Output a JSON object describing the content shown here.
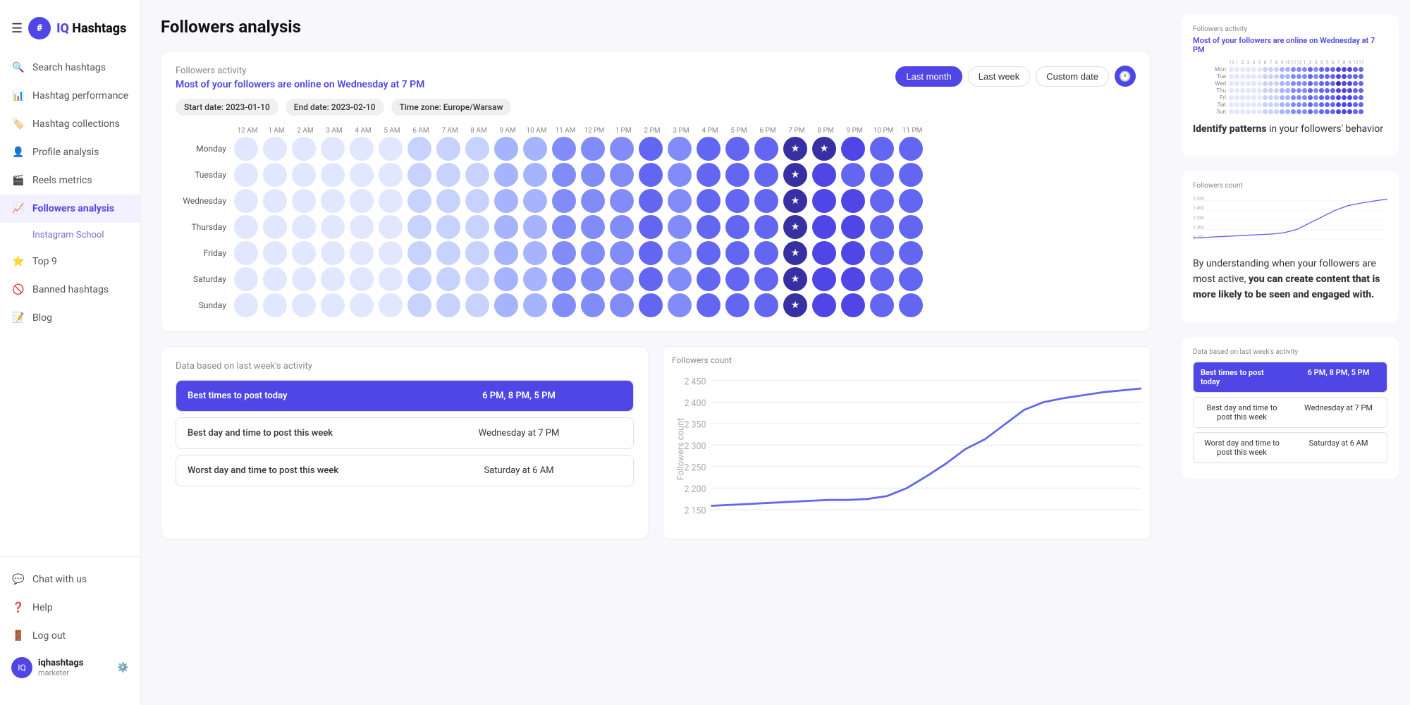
{
  "app": {
    "logo_symbol": "#",
    "logo_name_prefix": "IQ",
    "logo_name_suffix": " Hashtags"
  },
  "sidebar": {
    "hamburger": "☰",
    "items": [
      {
        "id": "search",
        "label": "Search hashtags",
        "icon": "🔍",
        "active": false
      },
      {
        "id": "hashtag-perf",
        "label": "Hashtag performance",
        "icon": "📊",
        "active": false
      },
      {
        "id": "hashtag-coll",
        "label": "Hashtag collections",
        "icon": "🏷️",
        "active": false
      },
      {
        "id": "profile",
        "label": "Profile analysis",
        "icon": "👤",
        "active": false
      },
      {
        "id": "reels",
        "label": "Reels metrics",
        "icon": "🎬",
        "active": false
      },
      {
        "id": "followers",
        "label": "Followers analysis",
        "icon": "📈",
        "active": true
      },
      {
        "id": "instagram-school",
        "label": "Instagram School",
        "icon": "🎓",
        "active": false,
        "sub": true
      },
      {
        "id": "top9",
        "label": "Top 9",
        "icon": "⭐",
        "active": false
      },
      {
        "id": "banned",
        "label": "Banned hashtags",
        "icon": "🚫",
        "active": false
      },
      {
        "id": "blog",
        "label": "Blog",
        "icon": "📝",
        "active": false
      }
    ],
    "user": {
      "initials": "IQ",
      "username": "iqhashtags",
      "role": "marketer"
    },
    "footer_items": [
      {
        "id": "chat",
        "label": "Chat with us",
        "icon": "💬"
      },
      {
        "id": "help",
        "label": "Help",
        "icon": "❓"
      },
      {
        "id": "logout",
        "label": "Log out",
        "icon": "🚪"
      }
    ]
  },
  "page": {
    "title": "Followers analysis"
  },
  "followers_activity": {
    "section_title": "Followers activity",
    "highlight": "Most of your followers are online on Wednesday at 7 PM",
    "filters": {
      "last_month": "Last month",
      "last_week": "Last week",
      "custom_date": "Custom date"
    },
    "active_filter": "Last month",
    "date_tags": [
      "Start date: 2023-01-10",
      "End date: 2023-02-10",
      "Time zone: Europe/Warsaw"
    ],
    "days": [
      "Monday",
      "Tuesday",
      "Wednesday",
      "Thursday",
      "Friday",
      "Saturday",
      "Sunday"
    ],
    "hours": [
      "12 AM",
      "1 AM",
      "2 AM",
      "3 AM",
      "4 AM",
      "5 AM",
      "6 AM",
      "7 AM",
      "8 AM",
      "9 AM",
      "10 AM",
      "11 AM",
      "12 PM",
      "1 PM",
      "2 PM",
      "3 PM",
      "4 PM",
      "5 PM",
      "6 PM",
      "7 PM",
      "8 PM",
      "9 PM",
      "10 PM",
      "11 PM"
    ]
  },
  "data_section": {
    "section_title": "Data based on last week's activity",
    "rows": [
      {
        "label": "Best times to post today",
        "value": "6 PM, 8 PM, 5 PM",
        "highlight": true
      },
      {
        "label": "Best day and time to post this week",
        "value": "Wednesday at 7 PM",
        "highlight": false
      },
      {
        "label": "Worst day and time to post this week",
        "value": "Saturday at 6 AM",
        "highlight": false
      }
    ]
  },
  "chart": {
    "title": "Followers count",
    "y_labels": [
      "2 450",
      "2 400",
      "2 350",
      "2 300",
      "2 250",
      "2 200",
      "2 150"
    ],
    "y_axis_label": "Followers count"
  },
  "right_panel": {
    "promo1": {
      "heading_normal": "Identify patterns",
      "heading_rest": " in your followers' behavior"
    },
    "promo2": {
      "text_before": "By understanding when your followers are most active, ",
      "text_bold": "you can create content that is more likely to be seen and engaged with."
    },
    "mini_data": {
      "section_title": "Data based on last week's activity",
      "rows": [
        {
          "label": "Best times to post today",
          "value": "6 PM, 8 PM, 5 PM",
          "highlight": true
        },
        {
          "label": "Best day and time to post this week",
          "value": "Wednesday at 7 PM",
          "highlight": false
        },
        {
          "label": "Worst day and time to post this week",
          "value": "Saturday at 6 AM",
          "highlight": false
        }
      ]
    },
    "mini_chart_title": "Followers count"
  },
  "colors": {
    "primary": "#4f46e5",
    "primary_light": "#a5b4fc",
    "primary_lighter": "#c7d2fe",
    "primary_lightest": "#e0e7ff",
    "primary_dark": "#3730a3"
  }
}
